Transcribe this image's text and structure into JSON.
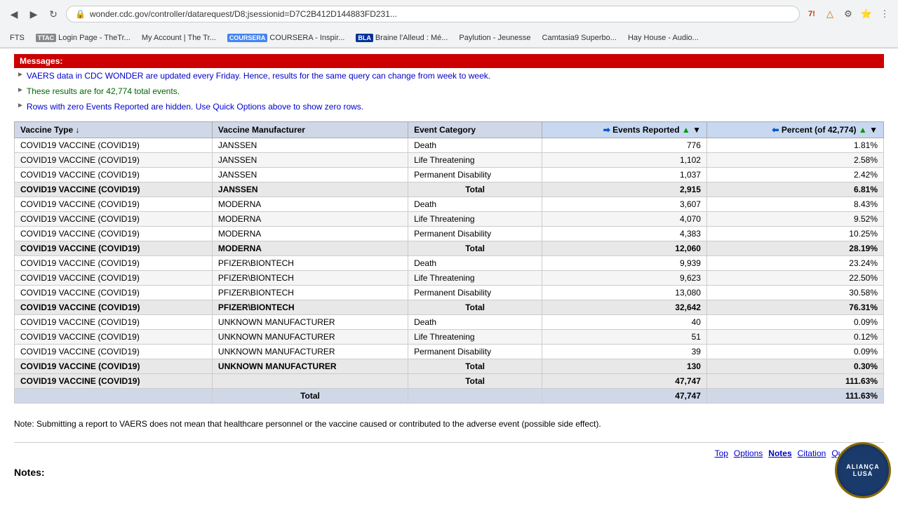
{
  "browser": {
    "url": "wonder.cdc.gov/controller/datarequest/D8;jsessionid=D7C2B412D144883FD231...",
    "back_icon": "◀",
    "forward_icon": "▶",
    "reload_icon": "↻",
    "security_icon": "🔒"
  },
  "bookmarks": [
    {
      "label": "FTS",
      "tag": "",
      "tag_color": ""
    },
    {
      "label": "TTAC",
      "tag": "TTAC",
      "tag_color": "#888"
    },
    {
      "label": "Login Page - TheTr...",
      "tag": "",
      "tag_color": ""
    },
    {
      "label": "My Account | The Tr...",
      "tag": "",
      "tag_color": ""
    },
    {
      "label": "COURSERA - Inspir...",
      "tag": "COURSERA",
      "tag_color": "#4285f4"
    },
    {
      "label": "Braine l'Alleud : Mé...",
      "tag": "BLA",
      "tag_color": "#003399"
    },
    {
      "label": "Paylution - Jeunesse",
      "tag": "",
      "tag_color": ""
    },
    {
      "label": "Camtasia9 Superbo...",
      "tag": "",
      "tag_color": ""
    },
    {
      "label": "Hay House - Audio...",
      "tag": "",
      "tag_color": ""
    }
  ],
  "messages": {
    "header": "Messages:",
    "items": [
      "VAERS data in CDC WONDER are updated every Friday. Hence, results for the same query can change from week to week.",
      "These results are for 42,774 total events.",
      "Rows with zero Events Reported are hidden. Use Quick Options above to show zero rows."
    ]
  },
  "table": {
    "headers": [
      {
        "label": "Vaccine Type ↓",
        "align": "left"
      },
      {
        "label": "Vaccine Manufacturer",
        "align": "left"
      },
      {
        "label": "Event Category",
        "align": "left"
      },
      {
        "label": "Events Reported ↑↓",
        "align": "right",
        "prefix": "➡"
      },
      {
        "label": "Percent (of 42,774) ↑↓",
        "align": "right",
        "prefix": "⬅"
      }
    ],
    "rows": [
      {
        "vaccine_type": "COVID19 VACCINE (COVID19)",
        "manufacturer": "JANSSEN",
        "category": "Death",
        "events": "776",
        "percent": "1.81%",
        "is_total": false
      },
      {
        "vaccine_type": "COVID19 VACCINE (COVID19)",
        "manufacturer": "JANSSEN",
        "category": "Life Threatening",
        "events": "1,102",
        "percent": "2.58%",
        "is_total": false
      },
      {
        "vaccine_type": "COVID19 VACCINE (COVID19)",
        "manufacturer": "JANSSEN",
        "category": "Permanent Disability",
        "events": "1,037",
        "percent": "2.42%",
        "is_total": false
      },
      {
        "vaccine_type": "COVID19 VACCINE (COVID19)",
        "manufacturer": "JANSSEN",
        "category": "Total",
        "events": "2,915",
        "percent": "6.81%",
        "is_total": true
      },
      {
        "vaccine_type": "COVID19 VACCINE (COVID19)",
        "manufacturer": "MODERNA",
        "category": "Death",
        "events": "3,607",
        "percent": "8.43%",
        "is_total": false
      },
      {
        "vaccine_type": "COVID19 VACCINE (COVID19)",
        "manufacturer": "MODERNA",
        "category": "Life Threatening",
        "events": "4,070",
        "percent": "9.52%",
        "is_total": false
      },
      {
        "vaccine_type": "COVID19 VACCINE (COVID19)",
        "manufacturer": "MODERNA",
        "category": "Permanent Disability",
        "events": "4,383",
        "percent": "10.25%",
        "is_total": false
      },
      {
        "vaccine_type": "COVID19 VACCINE (COVID19)",
        "manufacturer": "MODERNA",
        "category": "Total",
        "events": "12,060",
        "percent": "28.19%",
        "is_total": true
      },
      {
        "vaccine_type": "COVID19 VACCINE (COVID19)",
        "manufacturer": "PFIZER\\BIONTECH",
        "category": "Death",
        "events": "9,939",
        "percent": "23.24%",
        "is_total": false
      },
      {
        "vaccine_type": "COVID19 VACCINE (COVID19)",
        "manufacturer": "PFIZER\\BIONTECH",
        "category": "Life Threatening",
        "events": "9,623",
        "percent": "22.50%",
        "is_total": false
      },
      {
        "vaccine_type": "COVID19 VACCINE (COVID19)",
        "manufacturer": "PFIZER\\BIONTECH",
        "category": "Permanent Disability",
        "events": "13,080",
        "percent": "30.58%",
        "is_total": false
      },
      {
        "vaccine_type": "COVID19 VACCINE (COVID19)",
        "manufacturer": "PFIZER\\BIONTECH",
        "category": "Total",
        "events": "32,642",
        "percent": "76.31%",
        "is_total": true
      },
      {
        "vaccine_type": "COVID19 VACCINE (COVID19)",
        "manufacturer": "UNKNOWN MANUFACTURER",
        "category": "Death",
        "events": "40",
        "percent": "0.09%",
        "is_total": false
      },
      {
        "vaccine_type": "COVID19 VACCINE (COVID19)",
        "manufacturer": "UNKNOWN MANUFACTURER",
        "category": "Life Threatening",
        "events": "51",
        "percent": "0.12%",
        "is_total": false
      },
      {
        "vaccine_type": "COVID19 VACCINE (COVID19)",
        "manufacturer": "UNKNOWN MANUFACTURER",
        "category": "Permanent Disability",
        "events": "39",
        "percent": "0.09%",
        "is_total": false
      },
      {
        "vaccine_type": "COVID19 VACCINE (COVID19)",
        "manufacturer": "UNKNOWN MANUFACTURER",
        "category": "Total",
        "events": "130",
        "percent": "0.30%",
        "is_total": true
      },
      {
        "vaccine_type": "COVID19 VACCINE (COVID19)",
        "manufacturer": "",
        "category": "Total",
        "events": "47,747",
        "percent": "111.63%",
        "is_subtotal": true
      },
      {
        "vaccine_type": "",
        "manufacturer": "Total",
        "category": "",
        "events": "47,747",
        "percent": "111.63%",
        "is_grand_total": true
      }
    ]
  },
  "note": {
    "text": "Note: Submitting a report to VAERS does not mean that healthcare personnel or the vaccine caused or contributed to the adverse event (possible side effect)."
  },
  "footer": {
    "links": [
      "Top",
      "Options",
      "Notes",
      "Citation",
      "Query Criteria"
    ]
  },
  "notes_heading": "Notes:",
  "watermark": "ALIANÇA\nLUSA"
}
